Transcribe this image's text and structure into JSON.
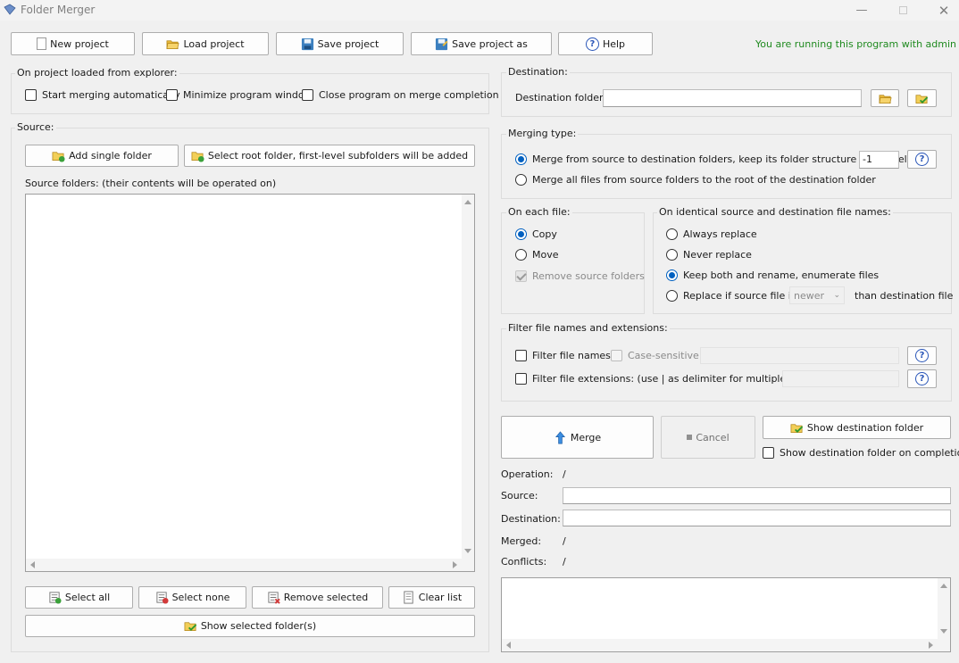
{
  "window": {
    "title": "Folder Merger"
  },
  "toolbar": {
    "new_project": "New project",
    "load_project": "Load project",
    "save_project": "Save project",
    "save_project_as": "Save project as",
    "help": "Help",
    "admin_notice": "You are running this program with admin rights."
  },
  "on_load": {
    "label": "On project loaded from explorer:",
    "start_merging": "Start merging automatically",
    "minimize": "Minimize program window",
    "close_on_completion": "Close program on merge completion"
  },
  "source": {
    "label": "Source:",
    "add_single": "Add single folder",
    "select_root": "Select root folder, first-level subfolders will be added",
    "list_label": "Source folders: (their contents will be operated on)",
    "select_all": "Select all",
    "select_none": "Select none",
    "remove_selected": "Remove selected",
    "clear_list": "Clear list",
    "show_selected": "Show selected folder(s)"
  },
  "destination": {
    "label": "Destination:",
    "folder_label": "Destination folder:",
    "folder_value": ""
  },
  "merging_type": {
    "label": "Merging type:",
    "keep_structure": "Merge from source to destination folders, keep its folder structure with level:",
    "level_value": "-1",
    "to_root": "Merge all files from source folders to the root of the destination folder"
  },
  "each_file": {
    "label": "On each file:",
    "copy": "Copy",
    "move": "Move",
    "remove_source": "Remove source folders"
  },
  "identical": {
    "label": "On identical source and destination file names:",
    "always": "Always replace",
    "never": "Never replace",
    "keep_both": "Keep both and rename, enumerate files",
    "replace_if": "Replace if source file is",
    "newer_option": "newer",
    "than_dest": "than destination file"
  },
  "filter": {
    "label": "Filter file names and extensions:",
    "names": "Filter file names:",
    "case_sensitive": "Case-sensitive",
    "extensions": "Filter file extensions: (use | as delimiter for multiple entries)"
  },
  "actions": {
    "merge": "Merge",
    "cancel": "Cancel",
    "show_dest": "Show destination folder",
    "show_dest_on_completion": "Show destination folder on completion"
  },
  "status": {
    "operation_label": "Operation:",
    "operation_value": "/",
    "source_label": "Source:",
    "destination_label": "Destination:",
    "merged_label": "Merged:",
    "merged_value": "/",
    "conflicts_label": "Conflicts:",
    "conflicts_value": "/"
  },
  "colors": {
    "admin_green": "#1f8a1f",
    "radio_blue": "#0060c0",
    "help_blue": "#2a56b8"
  }
}
